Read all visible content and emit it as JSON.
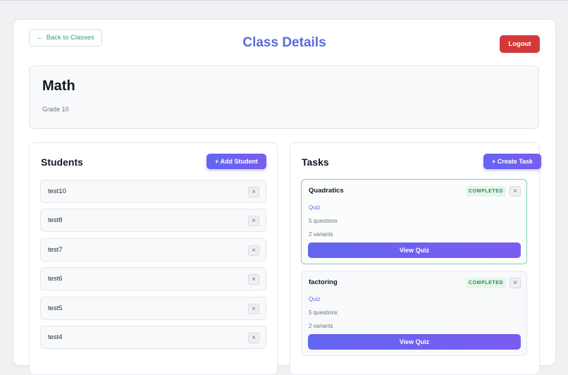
{
  "header": {
    "back_label": "Back to Classes",
    "title": "Class Details",
    "logout_label": "Logout"
  },
  "class_info": {
    "name": "Math",
    "grade": "Grade 10"
  },
  "students": {
    "title": "Students",
    "add_label": "+ Add Student",
    "items": [
      {
        "name": "test10"
      },
      {
        "name": "test8"
      },
      {
        "name": "test7"
      },
      {
        "name": "test6"
      },
      {
        "name": "test5"
      },
      {
        "name": "test4"
      }
    ]
  },
  "tasks": {
    "title": "Tasks",
    "create_label": "+ Create Task",
    "items": [
      {
        "title": "Quadratics",
        "status": "COMPLETED",
        "type": "Quiz",
        "questions": "5 questions",
        "variants": "2 variants",
        "action": "View Quiz"
      },
      {
        "title": "factoring",
        "status": "COMPLETED",
        "type": "Quiz",
        "questions": "5 questions",
        "variants": "2 variants",
        "action": "View Quiz"
      }
    ]
  },
  "icons": {
    "back": "arrow-left-icon",
    "remove": "close-icon"
  },
  "colors": {
    "accent": "#6366f1",
    "title": "#5b6bd8",
    "back_link": "#2aa38a",
    "logout": "#d23a3a",
    "badge_bg": "#e6f6ec",
    "badge_text": "#2f8a50"
  }
}
